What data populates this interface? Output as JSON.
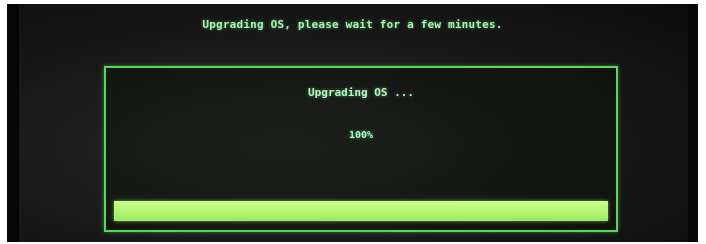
{
  "screen": {
    "top_message": "Upgrading OS, please wait for a few minutes."
  },
  "dialog": {
    "title": "Upgrading OS ...",
    "percent_text": "100%",
    "progress_fraction": 1.0
  },
  "colors": {
    "text": "#b4f5bf",
    "border": "#57d957",
    "progress": "#b8f778",
    "background": "#181818"
  }
}
